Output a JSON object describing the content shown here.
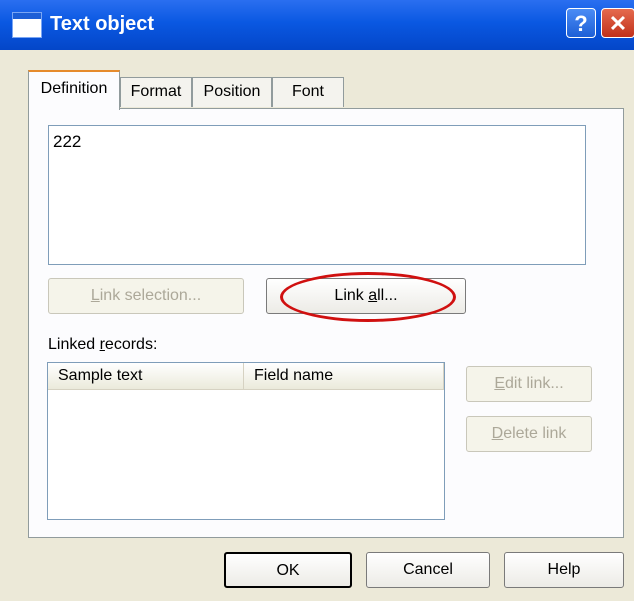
{
  "window": {
    "title": "Text object"
  },
  "tabs": [
    "Definition",
    "Format",
    "Position",
    "Font"
  ],
  "text_area": {
    "value": "222"
  },
  "buttons": {
    "link_selection": {
      "pre": "",
      "u": "L",
      "post": "ink selection..."
    },
    "link_all": {
      "pre": "Link ",
      "u": "a",
      "post": "ll..."
    },
    "edit_link": {
      "pre": "",
      "u": "E",
      "post": "dit link..."
    },
    "delete_link": {
      "pre": "",
      "u": "D",
      "post": "elete link"
    },
    "ok": "OK",
    "cancel": "Cancel",
    "help": "Help"
  },
  "linked_records": {
    "label": {
      "pre": "Linked ",
      "u": "r",
      "post": "ecords:"
    },
    "columns": [
      "Sample text",
      "Field name"
    ]
  },
  "annotation": {
    "color": "#d01010"
  }
}
